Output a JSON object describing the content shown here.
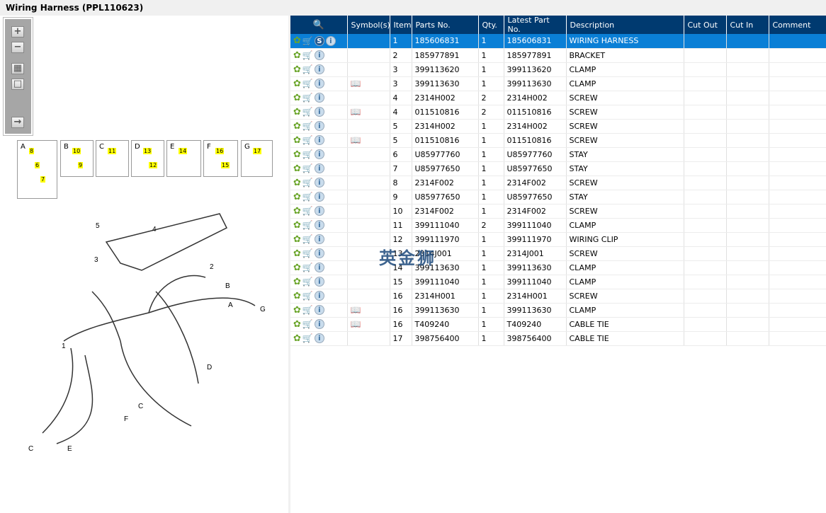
{
  "title": "Wiring Harness (PPL110623)",
  "watermark": "英金狮",
  "thumbnails": [
    {
      "letter": "A",
      "callouts": [
        "8",
        "6",
        "7"
      ]
    },
    {
      "letter": "B",
      "callouts": [
        "10",
        "9"
      ]
    },
    {
      "letter": "C",
      "callouts": [
        "11"
      ]
    },
    {
      "letter": "D",
      "callouts": [
        "13",
        "12"
      ]
    },
    {
      "letter": "E",
      "callouts": [
        "14"
      ]
    },
    {
      "letter": "F",
      "callouts": [
        "16",
        "15"
      ]
    },
    {
      "letter": "G",
      "callouts": [
        "17"
      ]
    }
  ],
  "diagram_labels": [
    "5",
    "4",
    "3",
    "2",
    "1",
    "A",
    "B",
    "G",
    "C",
    "D",
    "F",
    "C",
    "E"
  ],
  "columns": [
    "",
    "Symbol(s)",
    "Item",
    "Parts No.",
    "Qty.",
    "Latest Part No.",
    "Description",
    "Cut Out",
    "Cut In",
    "Comment"
  ],
  "rows": [
    {
      "sym": false,
      "item": "1",
      "part": "185606831",
      "qty": "1",
      "latest": "185606831",
      "desc": "WIRING HARNESS"
    },
    {
      "sym": false,
      "item": "2",
      "part": "185977891",
      "qty": "1",
      "latest": "185977891",
      "desc": "BRACKET"
    },
    {
      "sym": false,
      "item": "3",
      "part": "399113620",
      "qty": "1",
      "latest": "399113620",
      "desc": "CLAMP"
    },
    {
      "sym": true,
      "item": "3",
      "part": "399113630",
      "qty": "1",
      "latest": "399113630",
      "desc": "CLAMP"
    },
    {
      "sym": false,
      "item": "4",
      "part": "2314H002",
      "qty": "2",
      "latest": "2314H002",
      "desc": "SCREW"
    },
    {
      "sym": true,
      "item": "4",
      "part": "011510816",
      "qty": "2",
      "latest": "011510816",
      "desc": "SCREW"
    },
    {
      "sym": false,
      "item": "5",
      "part": "2314H002",
      "qty": "1",
      "latest": "2314H002",
      "desc": "SCREW"
    },
    {
      "sym": true,
      "item": "5",
      "part": "011510816",
      "qty": "1",
      "latest": "011510816",
      "desc": "SCREW"
    },
    {
      "sym": false,
      "item": "6",
      "part": "U85977760",
      "qty": "1",
      "latest": "U85977760",
      "desc": "STAY"
    },
    {
      "sym": false,
      "item": "7",
      "part": "U85977650",
      "qty": "1",
      "latest": "U85977650",
      "desc": "STAY"
    },
    {
      "sym": false,
      "item": "8",
      "part": "2314F002",
      "qty": "1",
      "latest": "2314F002",
      "desc": "SCREW"
    },
    {
      "sym": false,
      "item": "9",
      "part": "U85977650",
      "qty": "1",
      "latest": "U85977650",
      "desc": "STAY"
    },
    {
      "sym": false,
      "item": "10",
      "part": "2314F002",
      "qty": "1",
      "latest": "2314F002",
      "desc": "SCREW"
    },
    {
      "sym": false,
      "item": "11",
      "part": "399111040",
      "qty": "2",
      "latest": "399111040",
      "desc": "CLAMP"
    },
    {
      "sym": false,
      "item": "12",
      "part": "399111970",
      "qty": "1",
      "latest": "399111970",
      "desc": "WIRING CLIP"
    },
    {
      "sym": false,
      "item": "13",
      "part": "2314J001",
      "qty": "1",
      "latest": "2314J001",
      "desc": "SCREW"
    },
    {
      "sym": false,
      "item": "14",
      "part": "399113630",
      "qty": "1",
      "latest": "399113630",
      "desc": "CLAMP"
    },
    {
      "sym": false,
      "item": "15",
      "part": "399111040",
      "qty": "1",
      "latest": "399111040",
      "desc": "CLAMP"
    },
    {
      "sym": false,
      "item": "16",
      "part": "2314H001",
      "qty": "1",
      "latest": "2314H001",
      "desc": "SCREW"
    },
    {
      "sym": true,
      "item": "16",
      "part": "399113630",
      "qty": "1",
      "latest": "399113630",
      "desc": "CLAMP"
    },
    {
      "sym": true,
      "item": "16",
      "part": "T409240",
      "qty": "1",
      "latest": "T409240",
      "desc": "CABLE TIE"
    },
    {
      "sym": false,
      "item": "17",
      "part": "398756400",
      "qty": "1",
      "latest": "398756400",
      "desc": "CABLE TIE"
    }
  ]
}
